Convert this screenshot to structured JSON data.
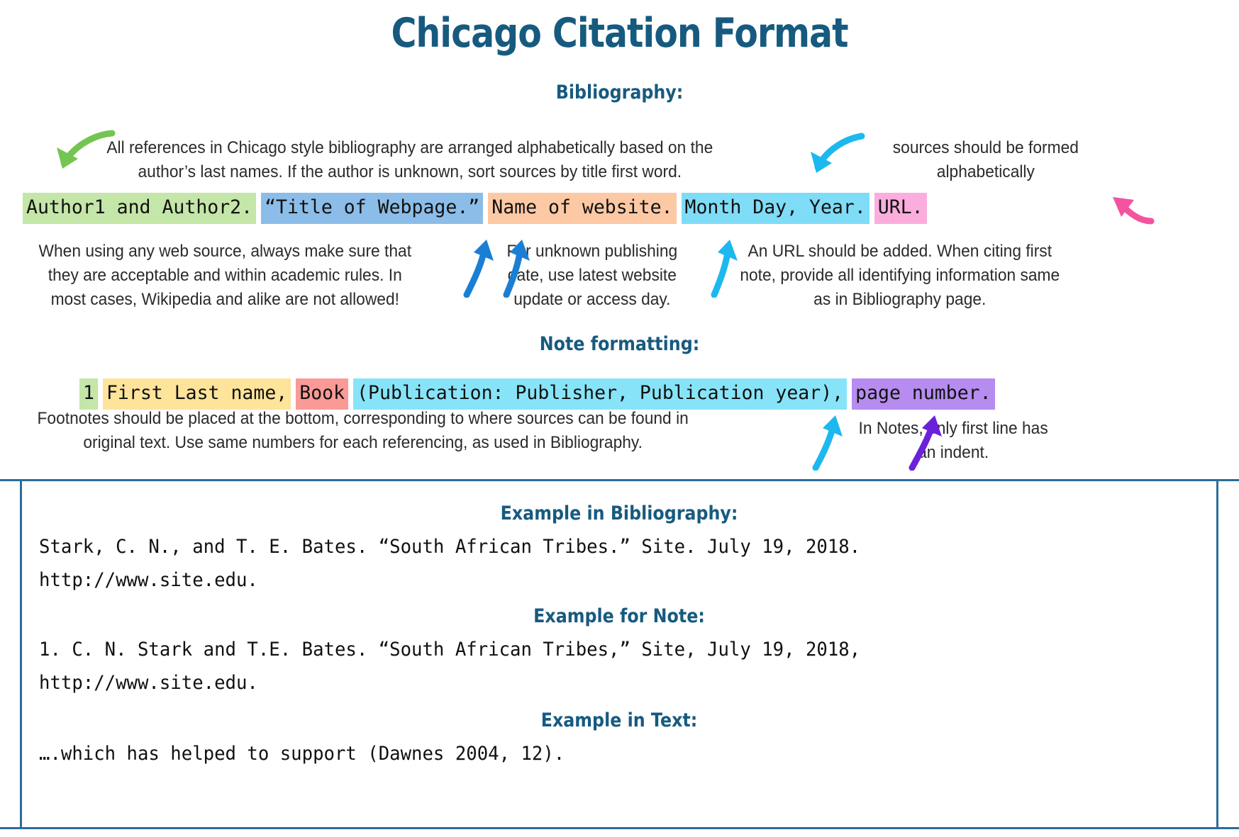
{
  "title": "Chicago Citation Format",
  "sections": {
    "bibliography_heading": "Bibliography:",
    "note_heading": "Note formatting:"
  },
  "annotations": {
    "alphabetical": "All references in Chicago style bibliography are arranged alphabetically based on the author’s last names. If the author is unknown, sort sources by title first word.",
    "sources_alphabetical": "sources should be formed alphabetically",
    "web_source": "When using any web source, always make sure that they are acceptable and within academic rules. In most cases, Wikipedia and alike are not allowed!",
    "unknown_date": "For unknown publishing date, use latest website update or access day.",
    "url_note": "An URL should be added. When citing first note, provide all identifying information same as in Bibliography page.",
    "footnotes": "Footnotes should be placed at the bottom, corresponding to where sources can be found in original text. Use same numbers for each referencing, as used in Bibliography.",
    "indent": "In Notes, only first line has an indent."
  },
  "bibliography_strip": [
    {
      "text": "Author1 and Author2.",
      "color": "#c4e6a8"
    },
    {
      "text": "“Title of Webpage.”",
      "color": "#8bbde8"
    },
    {
      "text": "Name of website.",
      "color": "#fcc9a4"
    },
    {
      "text": "Month Day, Year.",
      "color": "#7fdcf7"
    },
    {
      "text": "URL.",
      "color": "#fbaedd"
    }
  ],
  "note_strip": [
    {
      "text": "1",
      "color": "#c4e6a8"
    },
    {
      "text": "First Last name,",
      "color": "#fde49a"
    },
    {
      "text": "Book",
      "color": "#fa9a96"
    },
    {
      "text": "(Publication: Publisher, Publication year),",
      "color": "#87e4f8"
    },
    {
      "text": "page number.",
      "color": "#b68cf0"
    }
  ],
  "examples": {
    "bibliography_heading": "Example in Bibliography:",
    "bibliography_line1": "Stark, C. N., and T. E. Bates. “South African Tribes.” Site. July 19, 2018.",
    "bibliography_line2": "http://www.site.edu.",
    "note_heading": "Example for Note:",
    "note_line1": "1. C. N. Stark and T.E. Bates. “South African Tribes,” Site, July 19, 2018,",
    "note_line2": "http://www.site.edu.",
    "text_heading": "Example in Text:",
    "text_line1": "….which has helped to support (Dawnes 2004, 12)."
  },
  "colors": {
    "heading_blue": "#175a7f",
    "box_border": "#2c6d99",
    "arrow_green": "#74c552",
    "arrow_cyan": "#1cb8ef",
    "arrow_blue": "#1a7fd4",
    "arrow_pink": "#f4539f",
    "arrow_purple": "#6b21d9"
  },
  "arrows": [
    {
      "name": "green-curved-arrow-down-left"
    },
    {
      "name": "cyan-curved-arrow-down-left"
    },
    {
      "name": "pink-arrow-left"
    },
    {
      "name": "blue-arrow-up-title"
    },
    {
      "name": "blue-arrow-up-website"
    },
    {
      "name": "cyan-arrow-up-date"
    },
    {
      "name": "cyan-arrow-up-publication"
    },
    {
      "name": "purple-arrow-up-pagenumber"
    }
  ]
}
